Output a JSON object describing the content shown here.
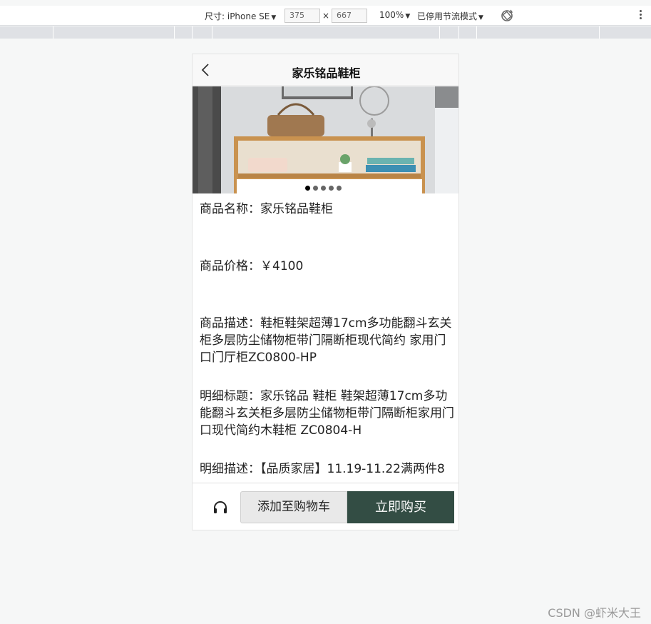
{
  "devtools": {
    "size_label": "尺寸: iPhone SE",
    "width": "375",
    "times": "×",
    "height": "667",
    "zoom": "100%",
    "throttle": "已停用节流模式",
    "icons": [
      "rotate-icon",
      "more-vert-icon"
    ]
  },
  "page": {
    "title": "家乐铭品鞋柜",
    "back_icon": "chevron-left-icon"
  },
  "carousel": {
    "slides": 5,
    "active": 0
  },
  "product": {
    "name_label": "商品名称：",
    "name": "家乐铭品鞋柜",
    "price_label": "商品价格：",
    "price": "￥4100",
    "desc_label": "商品描述：",
    "desc": "鞋柜鞋架超薄17cm多功能翻斗玄关柜多层防尘储物柜带门隔断柜现代简约 家用门口门厅柜ZC0800-HP",
    "detail_title_label": "明细标题：",
    "detail_title": "家乐铭品 鞋柜 鞋架超薄17cm多功能翻斗玄关柜多层防尘储物柜带门隔断柜家用门口现代简约木鞋柜 ZC0804-H",
    "detail_desc_label": "明细描述：",
    "detail_desc": "【品质家居】11.19-11.22满两件8"
  },
  "actions": {
    "service_icon": "headset-icon",
    "add_cart": "添加至购物车",
    "buy_now": "立即购买"
  },
  "watermark": "CSDN @虾米大王",
  "colors": {
    "buy_button": "#334d44",
    "cart_button": "#e9e9e9"
  }
}
